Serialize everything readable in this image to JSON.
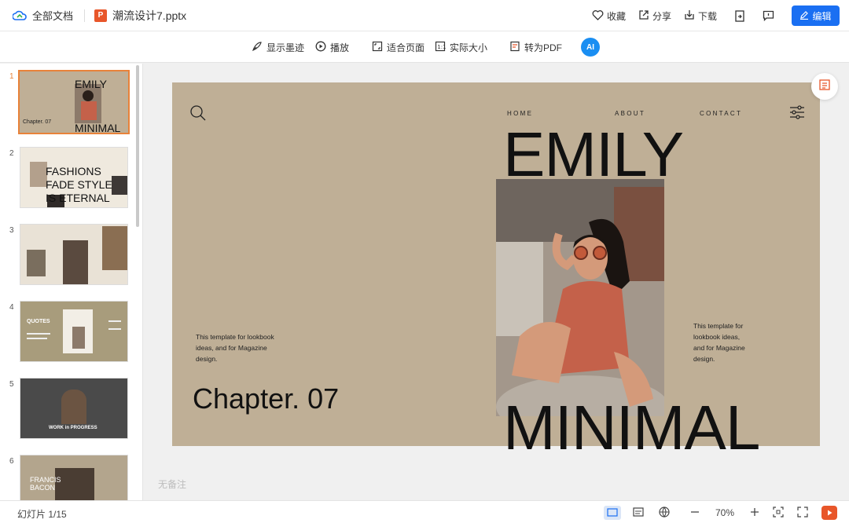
{
  "topbar": {
    "all_docs": "全部文档",
    "file_icon": "P",
    "filename": "潮流设计7.pptx",
    "favorite": "收藏",
    "share": "分享",
    "download": "下载",
    "edit": "编辑"
  },
  "toolbar": {
    "show_ink": "显示墨迹",
    "play": "播放",
    "fit_page": "适合页面",
    "actual_size": "实际大小",
    "to_pdf": "转为PDF",
    "ai_label": "AI"
  },
  "thumbnails": [
    {
      "num": "1",
      "active": true,
      "title1": "EMILY",
      "title2": "MINIMAL",
      "caption": "Chapter. 07"
    },
    {
      "num": "2",
      "active": false,
      "text": "FASHIONS FADE STYLE IS ETERNAL"
    },
    {
      "num": "3",
      "active": false
    },
    {
      "num": "4",
      "active": false,
      "text": "QUOTES"
    },
    {
      "num": "5",
      "active": false,
      "text": "WORK in PROGRESS"
    },
    {
      "num": "6",
      "active": false,
      "text": "FRANCIS BACON"
    }
  ],
  "slide": {
    "nav_home": "HOME",
    "nav_about": "ABOUT",
    "nav_contact": "CONTACT",
    "title_top": "EMILY",
    "title_bottom": "MINIMAL",
    "left_text": "This template for lookbook ideas, and for Magazine design.",
    "right_text": "This template for lookbook ideas, and for Magazine design.",
    "chapter": "Chapter. 07",
    "background": "#bfaf96"
  },
  "notes_placeholder": "无备注",
  "status": {
    "slide_counter": "幻灯片 1/15",
    "zoom": "70%"
  },
  "colors": {
    "accent": "#1a6ff2",
    "ppt_orange": "#e8562a",
    "active_thumb": "#e8823a"
  }
}
